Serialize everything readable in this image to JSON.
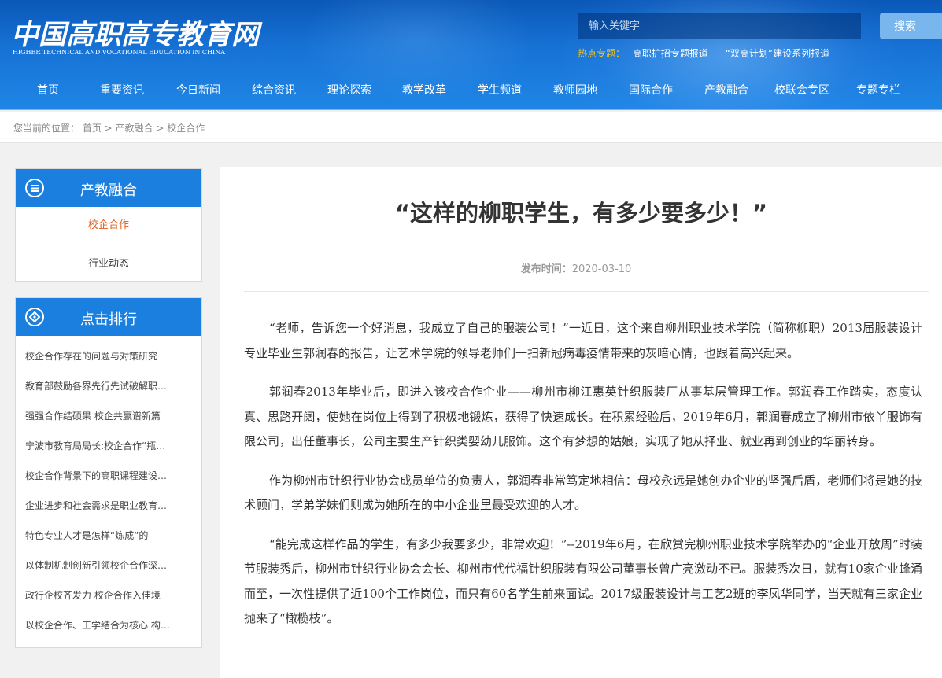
{
  "header": {
    "logo_cn": "中国高职高专教育网",
    "logo_en": "HIGHER TECHNICAL AND VOCATIONAL EDUCATION IN CHINA",
    "search_placeholder": "输入关键字",
    "search_button": "搜索",
    "hot_label": "热点专题：",
    "hot_links": [
      "高职扩招专题报道",
      "“双高计划”建设系列报道"
    ]
  },
  "nav": [
    "首页",
    "重要资讯",
    "今日新闻",
    "综合资讯",
    "理论探索",
    "教学改革",
    "学生频道",
    "教师园地",
    "国际合作",
    "产教融合",
    "校联会专区",
    "专题专栏"
  ],
  "breadcrumb": {
    "prefix": "您当前的位置：",
    "items": [
      "首页",
      "产教融合",
      "校企合作"
    ],
    "sep": " > "
  },
  "sidebar": {
    "category_title": "产教融合",
    "sub_items": [
      "校企合作",
      "行业动态"
    ],
    "rank_title": "点击排行",
    "rank_items": [
      "校企合作存在的问题与对策研究",
      "教育部鼓励各界先行先试破解职…",
      "强强合作结硕果 校企共赢谱新篇",
      "宁波市教育局局长:校企合作“瓶…",
      "校企合作背景下的高职课程建设…",
      "企业进步和社会需求是职业教育…",
      "特色专业人才是怎样“炼成”的",
      "以体制机制创新引领校企合作深…",
      "政行企校齐发力 校企合作入佳境",
      "以校企合作、工学结合为核心 构…"
    ]
  },
  "article": {
    "title": "“这样的柳职学生，有多少要多少！”",
    "date_label": "发布时间：",
    "date": "2020-03-10",
    "paragraphs": [
      "“老师，告诉您一个好消息，我成立了自己的服装公司！”一近日，这个来自柳州职业技术学院（简称柳职）2013届服装设计专业毕业生郭润春的报告，让艺术学院的领导老师们一扫新冠病毒疫情带来的灰暗心情，也跟着高兴起来。",
      "郭润春2013年毕业后，即进入该校合作企业——柳州市柳江惠英针织服装厂从事基层管理工作。郭润春工作踏实，态度认真、思路开阔，使她在岗位上得到了积极地锻炼，获得了快速成长。在积累经验后，2019年6月，郭润春成立了柳州市依丫服饰有限公司，出任董事长，公司主要生产针织类婴幼儿服饰。这个有梦想的姑娘，实现了她从择业、就业再到创业的华丽转身。",
      "作为柳州市针织行业协会成员单位的负责人，郭润春非常笃定地相信：母校永远是她创办企业的坚强后盾，老师们将是她的技术顾问，学弟学妹们则成为她所在的中小企业里最受欢迎的人才。",
      "“能完成这样作品的学生，有多少我要多少，非常欢迎！”--2019年6月，在欣赏完柳州职业技术学院举办的“企业开放周”时装节服装秀后，柳州市针织行业协会会长、柳州市代代福针织服装有限公司董事长曾广亮激动不已。服装秀次日，就有10家企业蜂涌而至，一次性提供了近100个工作岗位，而只有60名学生前来面试。2017级服装设计与工艺2班的李凤华同学，当天就有三家企业抛来了“橄榄枝”。"
    ]
  },
  "colors": {
    "header_blue": "#1773d6",
    "side_head_blue": "#1b7fe0",
    "active_orange": "#e05a17",
    "hot_label_yellow": "#f5c518",
    "search_button": "#7ab6ee"
  }
}
